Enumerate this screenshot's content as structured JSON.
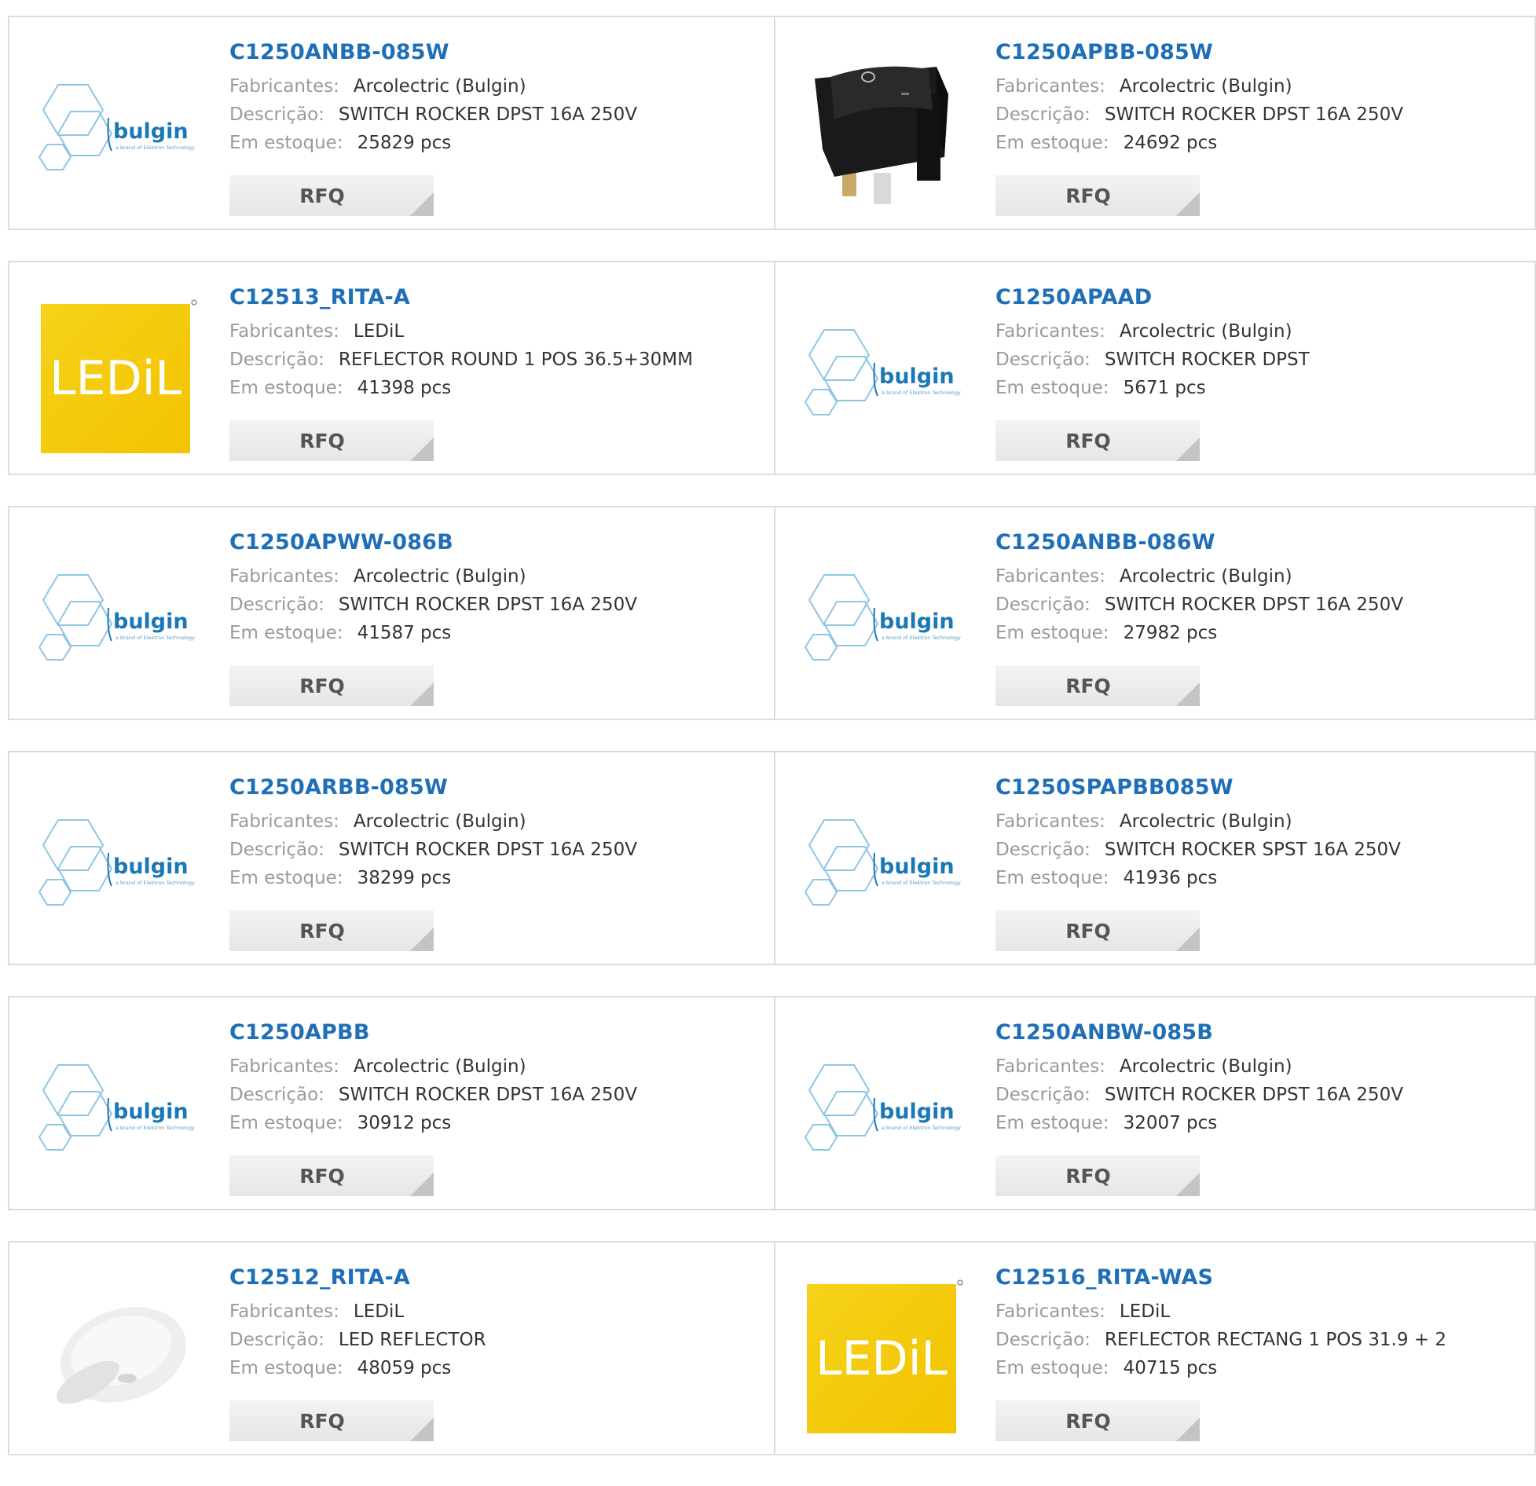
{
  "labels": {
    "manufacturer": "Fabricantes:",
    "description": "Descrição:",
    "stock": "Em estoque:",
    "rfq": "RFQ"
  },
  "products": [
    {
      "part": "C1250ANBB-085W",
      "manufacturer": "Arcolectric (Bulgin)",
      "description": "SWITCH ROCKER DPST 16A 250V",
      "stock": "25829 pcs",
      "image": "bulgin-logo"
    },
    {
      "part": "C1250APBB-085W",
      "manufacturer": "Arcolectric (Bulgin)",
      "description": "SWITCH ROCKER DPST 16A 250V",
      "stock": "24692 pcs",
      "image": "rocker-switch-photo"
    },
    {
      "part": "C12513_RITA-A",
      "manufacturer": "LEDiL",
      "description": "REFLECTOR ROUND 1 POS 36.5+30MM",
      "stock": "41398 pcs",
      "image": "ledil-logo"
    },
    {
      "part": "C1250APAAD",
      "manufacturer": "Arcolectric (Bulgin)",
      "description": "SWITCH ROCKER DPST",
      "stock": "5671 pcs",
      "image": "bulgin-logo"
    },
    {
      "part": "C1250APWW-086B",
      "manufacturer": "Arcolectric (Bulgin)",
      "description": "SWITCH ROCKER DPST 16A 250V",
      "stock": "41587 pcs",
      "image": "bulgin-logo"
    },
    {
      "part": "C1250ANBB-086W",
      "manufacturer": "Arcolectric (Bulgin)",
      "description": "SWITCH ROCKER DPST 16A 250V",
      "stock": "27982 pcs",
      "image": "bulgin-logo"
    },
    {
      "part": "C1250ARBB-085W",
      "manufacturer": "Arcolectric (Bulgin)",
      "description": "SWITCH ROCKER DPST 16A 250V",
      "stock": "38299 pcs",
      "image": "bulgin-logo"
    },
    {
      "part": "C1250SPAPBB085W",
      "manufacturer": "Arcolectric (Bulgin)",
      "description": "SWITCH ROCKER SPST 16A 250V",
      "stock": "41936 pcs",
      "image": "bulgin-logo"
    },
    {
      "part": "C1250APBB",
      "manufacturer": "Arcolectric (Bulgin)",
      "description": "SWITCH ROCKER DPST 16A 250V",
      "stock": "30912 pcs",
      "image": "bulgin-logo"
    },
    {
      "part": "C1250ANBW-085B",
      "manufacturer": "Arcolectric (Bulgin)",
      "description": "SWITCH ROCKER DPST 16A 250V",
      "stock": "32007 pcs",
      "image": "bulgin-logo"
    },
    {
      "part": "C12512_RITA-A",
      "manufacturer": "LEDiL",
      "description": "LED REFLECTOR",
      "stock": "48059 pcs",
      "image": "reflector-photo"
    },
    {
      "part": "C12516_RITA-WAS",
      "manufacturer": "LEDiL",
      "description": "REFLECTOR RECTANG 1 POS 31.9 + 2",
      "stock": "40715 pcs",
      "image": "ledil-logo"
    }
  ],
  "logo_text": {
    "bulgin": "bulgin",
    "bulgin_tagline": "a brand of Elektron Technology",
    "ledil": "LEDiL"
  },
  "colors": {
    "part_link": "#1f6eb8",
    "label": "#9a9a9a",
    "value": "#333333",
    "bulgin_blue": "#1a78b8",
    "ledil_yellow": "#f2c300"
  }
}
